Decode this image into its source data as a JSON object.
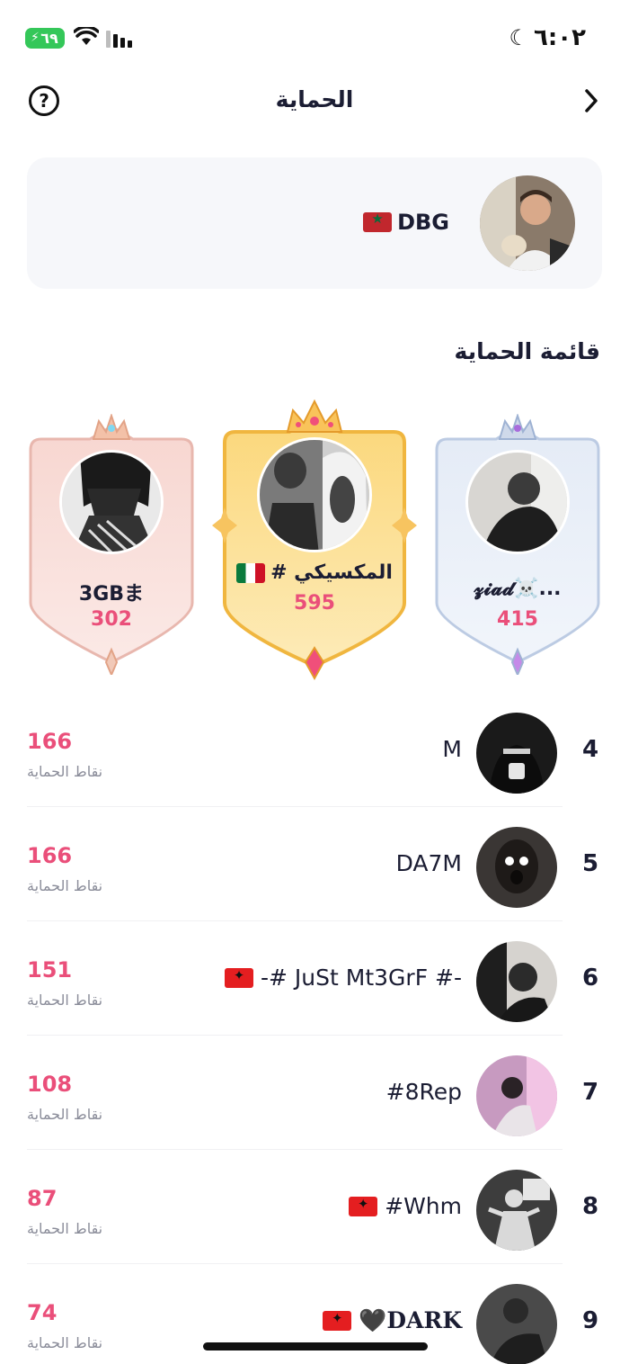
{
  "status_bar": {
    "time": "٦:٠٢",
    "battery": "٦٩"
  },
  "header": {
    "title": "الحماية"
  },
  "guard": {
    "name": "DBG"
  },
  "section_title": "قائمة الحماية",
  "podium": [
    {
      "rank": 2,
      "name": "3GBま",
      "score": "302"
    },
    {
      "rank": 1,
      "name": "# المكسيكي",
      "score": "595"
    },
    {
      "rank": 3,
      "name": "𝔃𝓲𝓪𝓭☠️...",
      "score": "415"
    }
  ],
  "points_label": "نقاط الحماية",
  "ranking": [
    {
      "rank": "4",
      "name": "M",
      "score": "166"
    },
    {
      "rank": "5",
      "name": "DA7M",
      "score": "166"
    },
    {
      "rank": "6",
      "name": "-# JuSt Mt3GrF #-",
      "score": "151"
    },
    {
      "rank": "7",
      "name": "#8Rep",
      "score": "108"
    },
    {
      "rank": "8",
      "name": "#Whm",
      "score": "87"
    },
    {
      "rank": "9",
      "name": "🖤DARK",
      "score": "74"
    }
  ],
  "colors": {
    "accent": "#ea4f7a",
    "text": "#1b1d33",
    "muted": "#8a8c99",
    "card_bg": "#f6f7fa"
  }
}
